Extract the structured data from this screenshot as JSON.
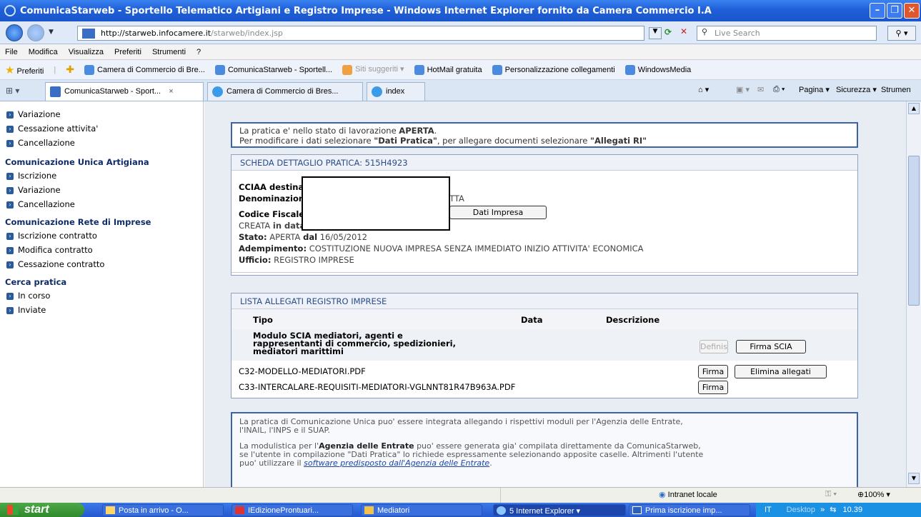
{
  "window": {
    "title": "ComunicaStarweb - Sportello Telematico Artigiani e Registro Imprese - Windows Internet Explorer fornito da Camera Commercio I.A"
  },
  "address": {
    "url_host": "http://starweb.infocamere.it",
    "url_path": "/starweb/index.jsp",
    "search_placeholder": "Live Search"
  },
  "menu": [
    "File",
    "Modifica",
    "Visualizza",
    "Preferiti",
    "Strumenti",
    "?"
  ],
  "favorites": {
    "label": "Preferiti",
    "items": [
      "Camera di Commercio di Bre...",
      "ComunicaStarweb - Sportell...",
      "Siti suggeriti",
      "HotMail gratuita",
      "Personalizzazione collegamenti",
      "WindowsMedia"
    ]
  },
  "tabs": [
    {
      "label": "ComunicaStarweb - Sport...",
      "close": "×"
    },
    {
      "label": "Camera di Commercio di Bres..."
    },
    {
      "label": "index"
    }
  ],
  "commands": [
    "Pagina",
    "Sicurezza",
    "Strumenti"
  ],
  "sidebar": {
    "group0": [
      "Variazione",
      "Cessazione attivita'",
      "Cancellazione"
    ],
    "group1": {
      "title": "Comunicazione Unica Artigiana",
      "items": [
        "Iscrizione",
        "Variazione",
        "Cancellazione"
      ]
    },
    "group2": {
      "title": "Comunicazione Rete di Imprese",
      "items": [
        "Iscrizione contratto",
        "Modifica contratto",
        "Cessazione contratto"
      ]
    },
    "group3": {
      "title": "Cerca pratica",
      "items": [
        "In corso",
        "Inviate"
      ]
    }
  },
  "notice": {
    "line1_prefix": "La pratica e' nello stato di lavorazione ",
    "line1_state": "APERTA",
    "line1_suffix": ".",
    "line2_prefix": "Per modificare i dati selezionare ",
    "line2_q1": "\"Dati Pratica\"",
    "line2_mid": ", per allegare documenti selezionare ",
    "line2_q2": "\"Allegati RI\""
  },
  "scheda": {
    "title": "SCHEDA DETTAGLIO PRATICA: 515H4923",
    "cciaa_label": "CCIAA destina",
    "denominazione_label": "Denominazion",
    "denominazione_tail": "TTA",
    "codice_label": "Codice Fiscale",
    "dati_impresa_btn": "Dati Impresa",
    "creata_prefix": "CREATA",
    "creata_in": "in data",
    "stato_label": "Stato:",
    "stato_value": "APERTA",
    "stato_dal": "dal",
    "stato_date": "16/05/2012",
    "adempimento_label": "Adempimento:",
    "adempimento_value": "COSTITUZIONE NUOVA IMPRESA SENZA IMMEDIATO INIZIO ATTIVITA' ECONOMICA",
    "ufficio_label": "Ufficio:",
    "ufficio_value": "REGISTRO IMPRESE"
  },
  "allegati": {
    "title": "LISTA ALLEGATI REGISTRO IMPRESE",
    "columns": [
      "Tipo",
      "Data",
      "Descrizione"
    ],
    "modulo": {
      "lines": [
        "Modulo SCIA mediatori, agenti e",
        "rappresentanti di commercio, spedizionieri,",
        "mediatori marittimi"
      ],
      "definisci": "Definisci",
      "firma_scia": "Firma SCIA"
    },
    "rows": [
      {
        "name": "C32-MODELLO-MEDIATORI.PDF",
        "firma": "Firma",
        "elimina": "Elimina allegati"
      },
      {
        "name": "C33-INTERCALARE-REQUISITI-MEDIATORI-VGLNNT81R47B963A.PDF",
        "firma": "Firma"
      }
    ]
  },
  "info": {
    "p1_l1": "La pratica di Comunicazione Unica puo' essere integrata allegando i rispettivi moduli per l'Agenzia delle Entrate,",
    "p1_l2": "l'INAIL, l'INPS e il SUAP.",
    "p2_l1_pre": "La modulistica per l'",
    "p2_l1_bold": "Agenzia delle Entrate",
    "p2_l1_post": " puo' essere generata gia' compilata direttamente da ComunicaStarweb,",
    "p2_l2": "se l'utente in compilazione \"Dati Pratica\" lo richiede espressamente selezionando apposite caselle. Altrimenti l'utente",
    "p2_l3_pre": "puo' utilizzare il ",
    "p2_l3_link": "software predisposto dall'Agenzia delle Entrate",
    "p2_l3_post": "."
  },
  "status": {
    "zone": "Intranet locale",
    "zoom": "100%"
  },
  "taskbar": {
    "start": "start",
    "tasks": [
      "Posta in arrivo - O...",
      "IEdizioneProntuari...",
      "Mediatori",
      "5 Internet Explorer",
      "Prima iscrizione imp..."
    ],
    "lang": "IT",
    "desktop": "Desktop",
    "clock": "10.39"
  }
}
